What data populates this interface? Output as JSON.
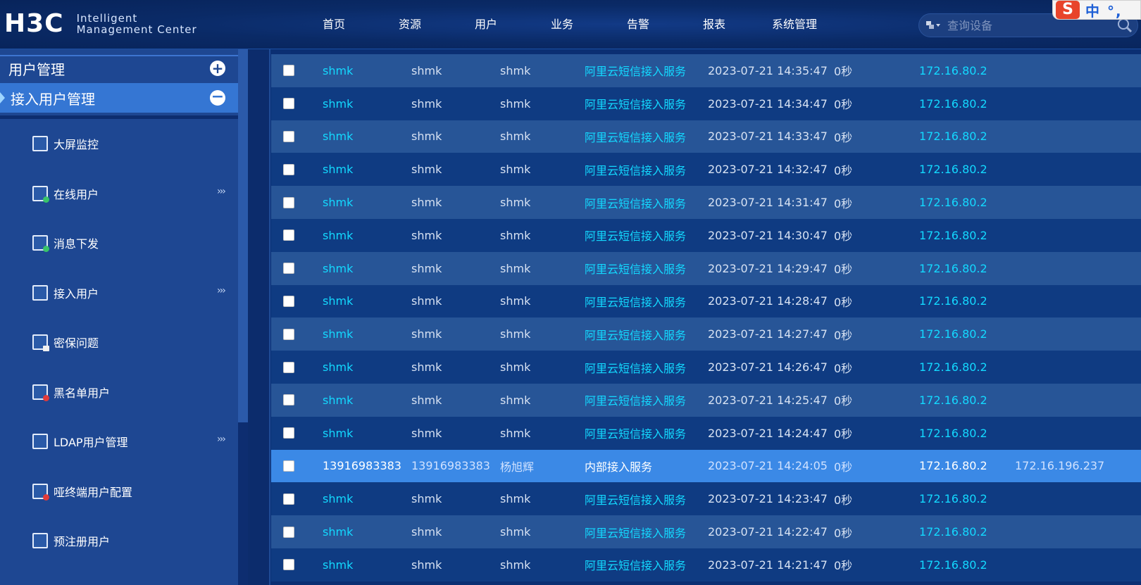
{
  "header": {
    "logo_mark": "H3C",
    "logo_line1": "Intelligent",
    "logo_line2": "Management Center",
    "nav": [
      "首页",
      "资源",
      "用户",
      "业务",
      "告警",
      "报表",
      "系统管理"
    ],
    "search_placeholder": "查询设备",
    "ime_s": "S",
    "ime_text": "中 °,"
  },
  "sidebar": {
    "section_title": "用户管理",
    "subsection_title": "接入用户管理",
    "items": [
      {
        "label": "大屏监控",
        "expandable": false
      },
      {
        "label": "在线用户",
        "expandable": true
      },
      {
        "label": "消息下发",
        "expandable": false
      },
      {
        "label": "接入用户",
        "expandable": true
      },
      {
        "label": "密保问题",
        "expandable": false
      },
      {
        "label": "黑名单用户",
        "expandable": false
      },
      {
        "label": "LDAP用户管理",
        "expandable": true
      },
      {
        "label": "哑终端用户配置",
        "expandable": false
      },
      {
        "label": "预注册用户",
        "expandable": false
      }
    ],
    "expand_glyph": "›››"
  },
  "table": {
    "rows": [
      {
        "account": "shmk",
        "login": "shmk",
        "name": "shmk",
        "service": "阿里云短信接入服务",
        "time": "2023-07-21 14:35:47",
        "duration": "0秒",
        "device_ip": "172.16.80.2",
        "user_ip": ""
      },
      {
        "account": "shmk",
        "login": "shmk",
        "name": "shmk",
        "service": "阿里云短信接入服务",
        "time": "2023-07-21 14:34:47",
        "duration": "0秒",
        "device_ip": "172.16.80.2",
        "user_ip": ""
      },
      {
        "account": "shmk",
        "login": "shmk",
        "name": "shmk",
        "service": "阿里云短信接入服务",
        "time": "2023-07-21 14:33:47",
        "duration": "0秒",
        "device_ip": "172.16.80.2",
        "user_ip": ""
      },
      {
        "account": "shmk",
        "login": "shmk",
        "name": "shmk",
        "service": "阿里云短信接入服务",
        "time": "2023-07-21 14:32:47",
        "duration": "0秒",
        "device_ip": "172.16.80.2",
        "user_ip": ""
      },
      {
        "account": "shmk",
        "login": "shmk",
        "name": "shmk",
        "service": "阿里云短信接入服务",
        "time": "2023-07-21 14:31:47",
        "duration": "0秒",
        "device_ip": "172.16.80.2",
        "user_ip": ""
      },
      {
        "account": "shmk",
        "login": "shmk",
        "name": "shmk",
        "service": "阿里云短信接入服务",
        "time": "2023-07-21 14:30:47",
        "duration": "0秒",
        "device_ip": "172.16.80.2",
        "user_ip": ""
      },
      {
        "account": "shmk",
        "login": "shmk",
        "name": "shmk",
        "service": "阿里云短信接入服务",
        "time": "2023-07-21 14:29:47",
        "duration": "0秒",
        "device_ip": "172.16.80.2",
        "user_ip": ""
      },
      {
        "account": "shmk",
        "login": "shmk",
        "name": "shmk",
        "service": "阿里云短信接入服务",
        "time": "2023-07-21 14:28:47",
        "duration": "0秒",
        "device_ip": "172.16.80.2",
        "user_ip": ""
      },
      {
        "account": "shmk",
        "login": "shmk",
        "name": "shmk",
        "service": "阿里云短信接入服务",
        "time": "2023-07-21 14:27:47",
        "duration": "0秒",
        "device_ip": "172.16.80.2",
        "user_ip": ""
      },
      {
        "account": "shmk",
        "login": "shmk",
        "name": "shmk",
        "service": "阿里云短信接入服务",
        "time": "2023-07-21 14:26:47",
        "duration": "0秒",
        "device_ip": "172.16.80.2",
        "user_ip": ""
      },
      {
        "account": "shmk",
        "login": "shmk",
        "name": "shmk",
        "service": "阿里云短信接入服务",
        "time": "2023-07-21 14:25:47",
        "duration": "0秒",
        "device_ip": "172.16.80.2",
        "user_ip": ""
      },
      {
        "account": "shmk",
        "login": "shmk",
        "name": "shmk",
        "service": "阿里云短信接入服务",
        "time": "2023-07-21 14:24:47",
        "duration": "0秒",
        "device_ip": "172.16.80.2",
        "user_ip": ""
      },
      {
        "account": "13916983383",
        "login": "13916983383",
        "name": "杨旭辉",
        "service": "内部接入服务",
        "time": "2023-07-21 14:24:05",
        "duration": "0秒",
        "device_ip": "172.16.80.2",
        "user_ip": "172.16.196.237",
        "selected": true
      },
      {
        "account": "shmk",
        "login": "shmk",
        "name": "shmk",
        "service": "阿里云短信接入服务",
        "time": "2023-07-21 14:23:47",
        "duration": "0秒",
        "device_ip": "172.16.80.2",
        "user_ip": ""
      },
      {
        "account": "shmk",
        "login": "shmk",
        "name": "shmk",
        "service": "阿里云短信接入服务",
        "time": "2023-07-21 14:22:47",
        "duration": "0秒",
        "device_ip": "172.16.80.2",
        "user_ip": ""
      },
      {
        "account": "shmk",
        "login": "shmk",
        "name": "shmk",
        "service": "阿里云短信接入服务",
        "time": "2023-07-21 14:21:47",
        "duration": "0秒",
        "device_ip": "172.16.80.2",
        "user_ip": ""
      }
    ]
  },
  "colors": {
    "link": "#13d9ff",
    "row_odd": "#275597",
    "row_even": "#0f3b82",
    "row_selected": "#3b89e6",
    "sidebar": "#1e4792",
    "sidebar_active": "#3576d3"
  }
}
